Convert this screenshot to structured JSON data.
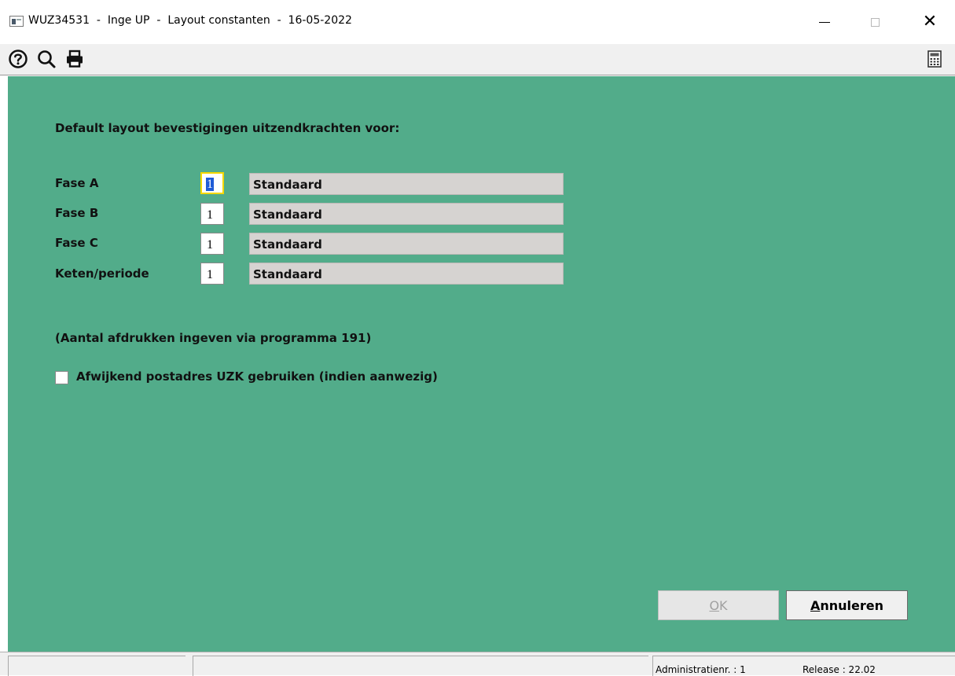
{
  "window": {
    "title": "WUZ34531  -  Inge UP  -  Layout constanten  -  16-05-2022",
    "minimize_glyph": "—",
    "close_glyph": "✕"
  },
  "toolbar": {
    "icons": [
      "help-icon",
      "search-icon",
      "print-icon",
      "calculator-icon"
    ]
  },
  "form": {
    "heading": "Default layout bevestigingen uitzendkrachten voor:",
    "rows": [
      {
        "label": "Fase A",
        "code": "1",
        "description": "Standaard"
      },
      {
        "label": "Fase B",
        "code": "1",
        "description": "Standaard"
      },
      {
        "label": "Fase C",
        "code": "1",
        "description": "Standaard"
      },
      {
        "label": "Keten/periode",
        "code": "1",
        "description": "Standaard"
      }
    ],
    "note": "(Aantal afdrukken ingeven via programma 191)",
    "checkbox_label": "Afwijkend postadres UZK gebruiken (indien aanwezig)",
    "checkbox_checked": false
  },
  "buttons": {
    "ok_mnemonic": "O",
    "ok_rest": "K",
    "cancel_mnemonic": "A",
    "cancel_rest": "nnuleren"
  },
  "statusbar": {
    "administratie": "Administratienr. :   1",
    "release": "Release : 22.02"
  },
  "colors": {
    "panel_bg": "#52ac8a",
    "desc_bg": "#d6d3d1",
    "focus_border": "#f5d800",
    "selection": "#1e5bd6"
  }
}
